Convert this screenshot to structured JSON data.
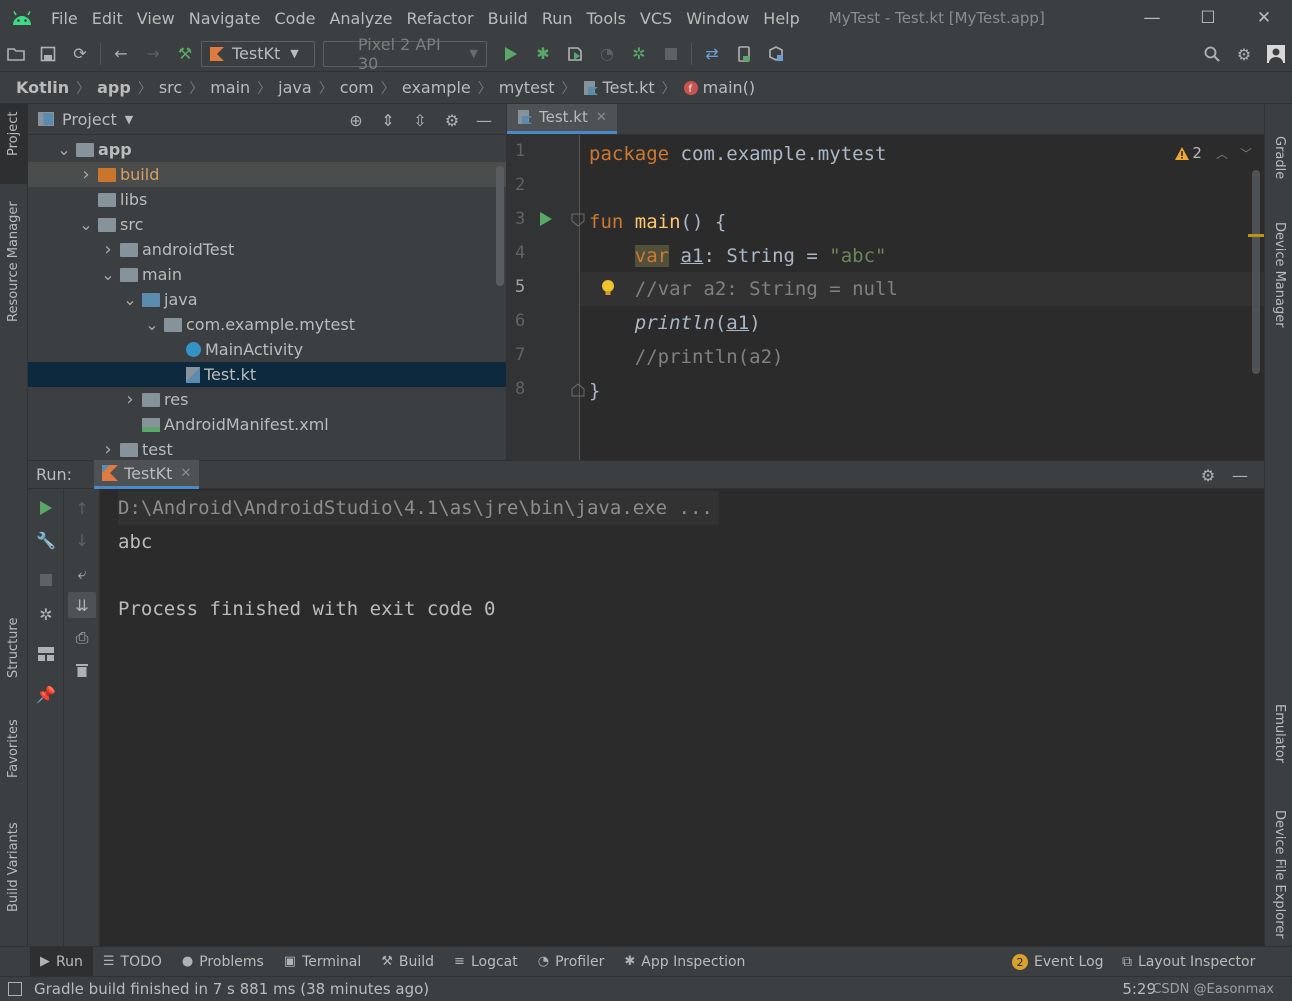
{
  "menubar": {
    "items": [
      "File",
      "Edit",
      "View",
      "Navigate",
      "Code",
      "Analyze",
      "Refactor",
      "Build",
      "Run",
      "Tools",
      "VCS",
      "Window",
      "Help"
    ],
    "window_title": "MyTest - Test.kt [MyTest.app]",
    "logo_icon": "android-icon"
  },
  "toolbar": {
    "run_config": "TestKt",
    "device": "Pixel 2 API 30"
  },
  "breadcrumb": [
    "Kotlin",
    "app",
    "src",
    "main",
    "java",
    "com",
    "example",
    "mytest",
    "Test.kt",
    "main()"
  ],
  "left_stripe": {
    "project": "Project",
    "resource_manager": "Resource Manager",
    "structure": "Structure",
    "favorites": "Favorites",
    "build_variants": "Build Variants"
  },
  "right_stripe": {
    "gradle": "Gradle",
    "device_manager": "Device Manager",
    "emulator": "Emulator",
    "device_file_explorer": "Device File Explorer"
  },
  "project": {
    "title": "Project",
    "tree": [
      {
        "label": "app",
        "depth": 0,
        "expanded": true,
        "icon": "module-folder",
        "bold": true
      },
      {
        "label": "build",
        "depth": 1,
        "expanded": false,
        "icon": "folder-orange"
      },
      {
        "label": "libs",
        "depth": 1,
        "expanded": null,
        "icon": "folder"
      },
      {
        "label": "src",
        "depth": 1,
        "expanded": true,
        "icon": "folder"
      },
      {
        "label": "androidTest",
        "depth": 2,
        "expanded": false,
        "icon": "folder"
      },
      {
        "label": "main",
        "depth": 2,
        "expanded": true,
        "icon": "folder"
      },
      {
        "label": "java",
        "depth": 3,
        "expanded": true,
        "icon": "folder-blue"
      },
      {
        "label": "com.example.mytest",
        "depth": 4,
        "expanded": true,
        "icon": "package"
      },
      {
        "label": "MainActivity",
        "depth": 5,
        "expanded": null,
        "icon": "kotlin-class"
      },
      {
        "label": "Test.kt",
        "depth": 5,
        "expanded": null,
        "icon": "kotlin-file",
        "selected": true
      },
      {
        "label": "res",
        "depth": 3,
        "expanded": false,
        "icon": "folder"
      },
      {
        "label": "AndroidManifest.xml",
        "depth": 3,
        "expanded": null,
        "icon": "manifest"
      },
      {
        "label": "test",
        "depth": 2,
        "expanded": false,
        "icon": "folder"
      }
    ]
  },
  "editor": {
    "tab": "Test.kt",
    "warnings": "2",
    "current_line": "5",
    "line_numbers": [
      "1",
      "2",
      "3",
      "4",
      "5",
      "6",
      "7",
      "8"
    ],
    "code": {
      "l1_kw": "package",
      "l1_rest": " com.example.mytest",
      "l3_kw": "fun",
      "l3_fn": " main",
      "l3_rest": "() {",
      "l4_kw": "var",
      "l4_var": "a1",
      "l4_mid": ": String = ",
      "l4_str": "\"abc\"",
      "l5_comment": "//var a2: String = null",
      "l6_fn": "println",
      "l6_open": "(",
      "l6_arg": "a1",
      "l6_close": ")",
      "l7_comment": "//println(a2)",
      "l8": "}"
    }
  },
  "run": {
    "label": "Run:",
    "tab": "TestKt",
    "console": [
      "D:\\Android\\AndroidStudio\\4.1\\as\\jre\\bin\\java.exe ...",
      "abc",
      "",
      "Process finished with exit code 0"
    ]
  },
  "bottom_tools": {
    "left": [
      "Run",
      "TODO",
      "Problems",
      "Terminal",
      "Build",
      "Logcat",
      "Profiler",
      "App Inspection"
    ],
    "event_log": "Event Log",
    "event_count": "2",
    "layout_inspector": "Layout Inspector"
  },
  "status": {
    "message": "Gradle build finished in 7 s 881 ms (38 minutes ago)",
    "position": "5:29",
    "watermark": "CSDN @Easonmax"
  },
  "colors": {
    "keyword": "#cc7832",
    "string": "#6a8759",
    "comment": "#808080",
    "function": "#ffc66d",
    "selection": "#0d293e",
    "accent": "#4a88c7"
  }
}
